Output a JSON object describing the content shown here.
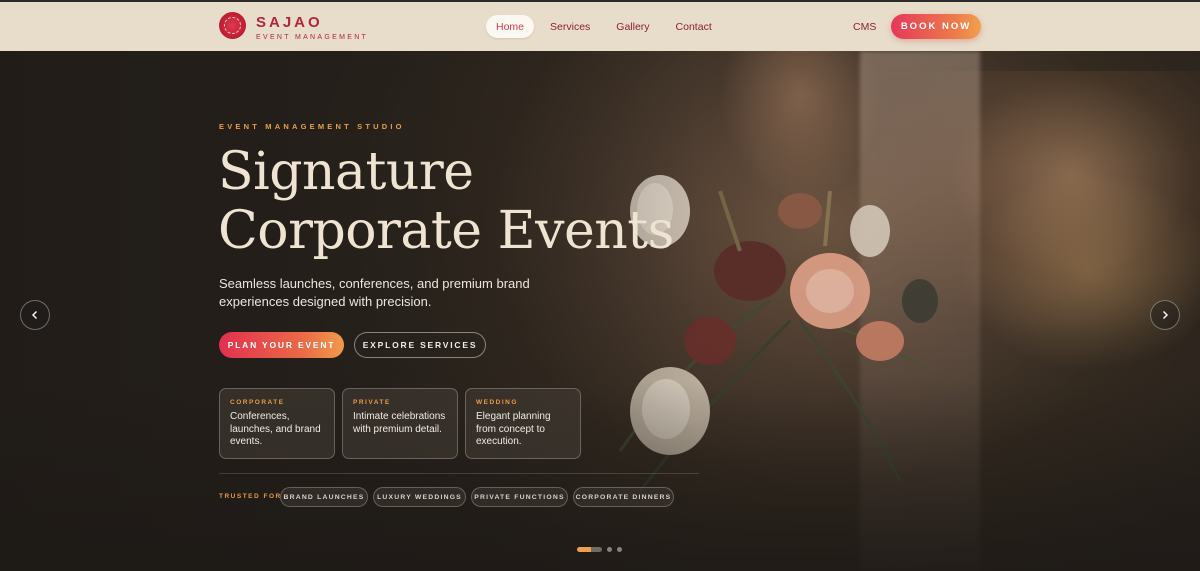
{
  "brand": {
    "name": "SAJAO",
    "tagline": "EVENT MANAGEMENT"
  },
  "nav": {
    "items": [
      {
        "label": "Home",
        "active": true
      },
      {
        "label": "Services",
        "active": false
      },
      {
        "label": "Gallery",
        "active": false
      },
      {
        "label": "Contact",
        "active": false
      }
    ],
    "cms_label": "CMS",
    "book_label": "BOOK NOW"
  },
  "hero": {
    "eyebrow": "EVENT MANAGEMENT STUDIO",
    "title_line1": "Signature",
    "title_line2": "Corporate Events",
    "subtitle": "Seamless launches, conferences, and premium brand experiences designed with precision.",
    "primary_button": "PLAN YOUR EVENT",
    "secondary_button": "EXPLORE SERVICES",
    "cards": [
      {
        "label": "CORPORATE",
        "text": "Conferences, launches, and brand events."
      },
      {
        "label": "PRIVATE",
        "text": "Intimate celebrations with premium detail."
      },
      {
        "label": "WEDDING",
        "text": "Elegant planning from concept to execution."
      }
    ],
    "trusted_label": "TRUSTED FOR",
    "chips": [
      "BRAND LAUNCHES",
      "LUXURY WEDDINGS",
      "PRIVATE FUNCTIONS",
      "CORPORATE DINNERS"
    ]
  },
  "carousel": {
    "slide_count": 3,
    "active_index": 0,
    "prev_icon": "chevron-left-icon",
    "next_icon": "chevron-right-icon"
  },
  "colors": {
    "accent": "#e3304f",
    "accent_warm": "#f09a4a",
    "brand": "#b3253a",
    "header_bg": "#e8dcca"
  }
}
